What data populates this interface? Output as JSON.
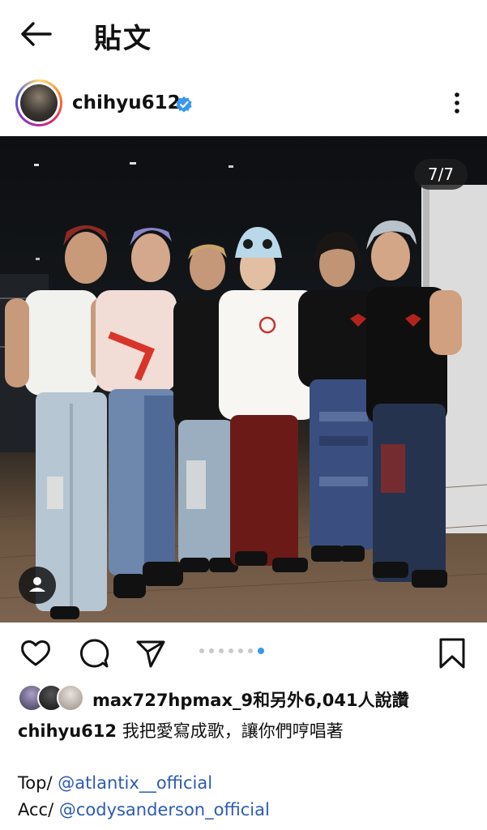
{
  "header": {
    "title": "貼文"
  },
  "post": {
    "username": "chihyu612",
    "slide_counter": "7/7",
    "slide_count": 7,
    "active_slide": 7
  },
  "likes": {
    "liker": "max727hpmax_9",
    "text": "和另外6,041人說讚"
  },
  "caption": {
    "username": "chihyu612",
    "text": " 我把愛寫成歌，讓你們哼唱著"
  },
  "credits": [
    {
      "label": "Top/ ",
      "mention": "@atlantix__official"
    },
    {
      "label": "Acc/ ",
      "mention": "@codysanderson_official"
    }
  ],
  "icons": {
    "back": "arrow-left-icon",
    "verified": "verified-badge-icon",
    "more": "more-vertical-icon",
    "tag": "person-tag-icon",
    "like": "heart-icon",
    "comment": "comment-icon",
    "share": "send-icon",
    "save": "bookmark-icon"
  },
  "colors": {
    "verified": "#3897f0",
    "mention": "#2d5bb3",
    "active_dot": "#3897f0"
  }
}
